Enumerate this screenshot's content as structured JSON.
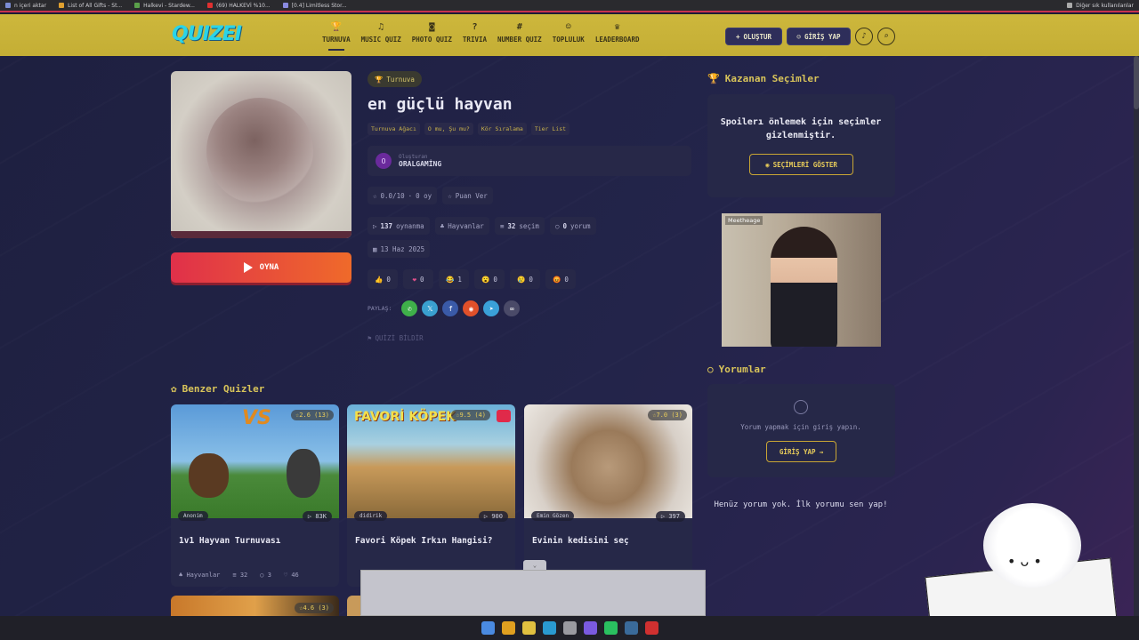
{
  "browser": {
    "bookmarks": [
      {
        "label": "n içeri aktar",
        "color": "#7b8cd4"
      },
      {
        "label": "List of All Gifts - St...",
        "color": "#e0a030"
      },
      {
        "label": "Halkevi - Stardew...",
        "color": "#5aa04a"
      },
      {
        "label": "(69) HALKEVİ %10...",
        "color": "#e03030"
      },
      {
        "label": "[0.4] Limitless Stor...",
        "color": "#8a8ae0"
      }
    ],
    "other_bookmarks": "Diğer sık kullanılanlar"
  },
  "nav": {
    "logo": "QUIZEI",
    "items": [
      {
        "label": "TURNUVA",
        "icon": "trophy-icon",
        "glyph": "🏆"
      },
      {
        "label": "MUSIC QUIZ",
        "icon": "music-icon",
        "glyph": "♫"
      },
      {
        "label": "PHOTO QUIZ",
        "icon": "camera-icon",
        "glyph": "◙"
      },
      {
        "label": "TRIVIA",
        "icon": "question-icon",
        "glyph": "?"
      },
      {
        "label": "NUMBER QUIZ",
        "icon": "hash-icon",
        "glyph": "#"
      },
      {
        "label": "TOPLULUK",
        "icon": "people-icon",
        "glyph": "☺"
      },
      {
        "label": "LEADERBOARD",
        "icon": "crown-icon",
        "glyph": "♛"
      }
    ],
    "create_label": "OLUŞTUR",
    "login_label": "GİRİŞ YAP"
  },
  "quiz": {
    "category_badge": "Turnuva",
    "title": "en güçlü hayvan",
    "tags": [
      "Turnuva Ağacı",
      "O mu, Şu mu?",
      "Kör Sıralama",
      "Tier List"
    ],
    "creator_label": "Oluşturan",
    "creator_name": "ORALGAMİNG",
    "creator_initial": "O",
    "rating": "0.0/10",
    "votes": "0 oy",
    "rate_label": "Puan Ver",
    "plays_count": "137",
    "plays_label": "oynanma",
    "category": "Hayvanlar",
    "choices_count": "32",
    "choices_label": "seçim",
    "comments_count": "0",
    "comments_label": "yorum",
    "date": "13 Haz 2025",
    "play_label": "OYNA",
    "reactions": [
      {
        "glyph": "👍",
        "count": "0"
      },
      {
        "glyph": "❤",
        "count": "0"
      },
      {
        "glyph": "😂",
        "count": "1"
      },
      {
        "glyph": "😮",
        "count": "0"
      },
      {
        "glyph": "😢",
        "count": "0"
      },
      {
        "glyph": "😡",
        "count": "0"
      }
    ],
    "share_label": "PAYLAŞ:",
    "share_buttons": [
      {
        "name": "whatsapp",
        "color": "#3fb04a",
        "glyph": "✆"
      },
      {
        "name": "x",
        "color": "#3aa0d0",
        "glyph": "𝕏"
      },
      {
        "name": "facebook",
        "color": "#3a5aa8",
        "glyph": "f"
      },
      {
        "name": "reddit",
        "color": "#e0502a",
        "glyph": "◉"
      },
      {
        "name": "telegram",
        "color": "#3aa0d8",
        "glyph": "➤"
      },
      {
        "name": "link",
        "color": "#4a4a68",
        "glyph": "∞"
      }
    ],
    "report_label": "QUİZİ BİLDİR"
  },
  "sidebar": {
    "winners_title": "Kazanan Seçimler",
    "spoiler_text": "Spoilerı önlemek için seçimler gizlenmiştir.",
    "show_button": "SEÇİMLERİ GÖSTER",
    "ad_label": "Meetheage",
    "comments_title": "Yorumlar",
    "comment_prompt": "Yorum yapmak için giriş yapın.",
    "login_button": "GİRİŞ YAP",
    "no_comments": "Henüz yorum yok. İlk yorumu sen yap!"
  },
  "similar": {
    "title": "Benzer Quizler",
    "cards": [
      {
        "title": "1v1 Hayvan Turnuvası",
        "rating": "2.6",
        "rating_count": "(13)",
        "author": "Anonim",
        "plays": "83K",
        "category": "Hayvanlar",
        "choices": "32",
        "comments": "3",
        "likes": "46",
        "bg": "linear-gradient(#5a9ad8 0%, #8ac0e8 50%, #4a8a3a 62%, #3a7a2a 100%)"
      },
      {
        "title": "Favori Köpek Irkın Hangisi?",
        "rating": "9.5",
        "rating_count": "(4)",
        "author": "didirik",
        "plays": "900",
        "category": "",
        "choices": "",
        "comments": "",
        "likes": "",
        "bg": "linear-gradient(#6ab0d8 0%, #a8d0e0 35%, #c89a5a 55%, #8a6a3a 100%)",
        "overlay": "FAVORİ KÖPEK"
      },
      {
        "title": "Evinin kedisini seç",
        "rating": "7.0",
        "rating_count": "(3)",
        "author": "Emin Gözen",
        "plays": "397",
        "category": "",
        "choices": "",
        "comments": "",
        "likes": "",
        "bg": "radial-gradient(circle at 50% 55%, #b89a7a 0%, #9a7a5a 35%, #d8d0c8 70%, #ece8e2 100%)"
      }
    ],
    "row2_rating": "4.6",
    "row2_rating_count": "(3)"
  },
  "taskbar": {
    "icons": [
      "#4a8ae0",
      "#e0a020",
      "#e0c040",
      "#2a9ad0",
      "#9a9aa0",
      "#7a5ae0",
      "#2ac060",
      "#3a6a9a",
      "#d03030"
    ]
  }
}
